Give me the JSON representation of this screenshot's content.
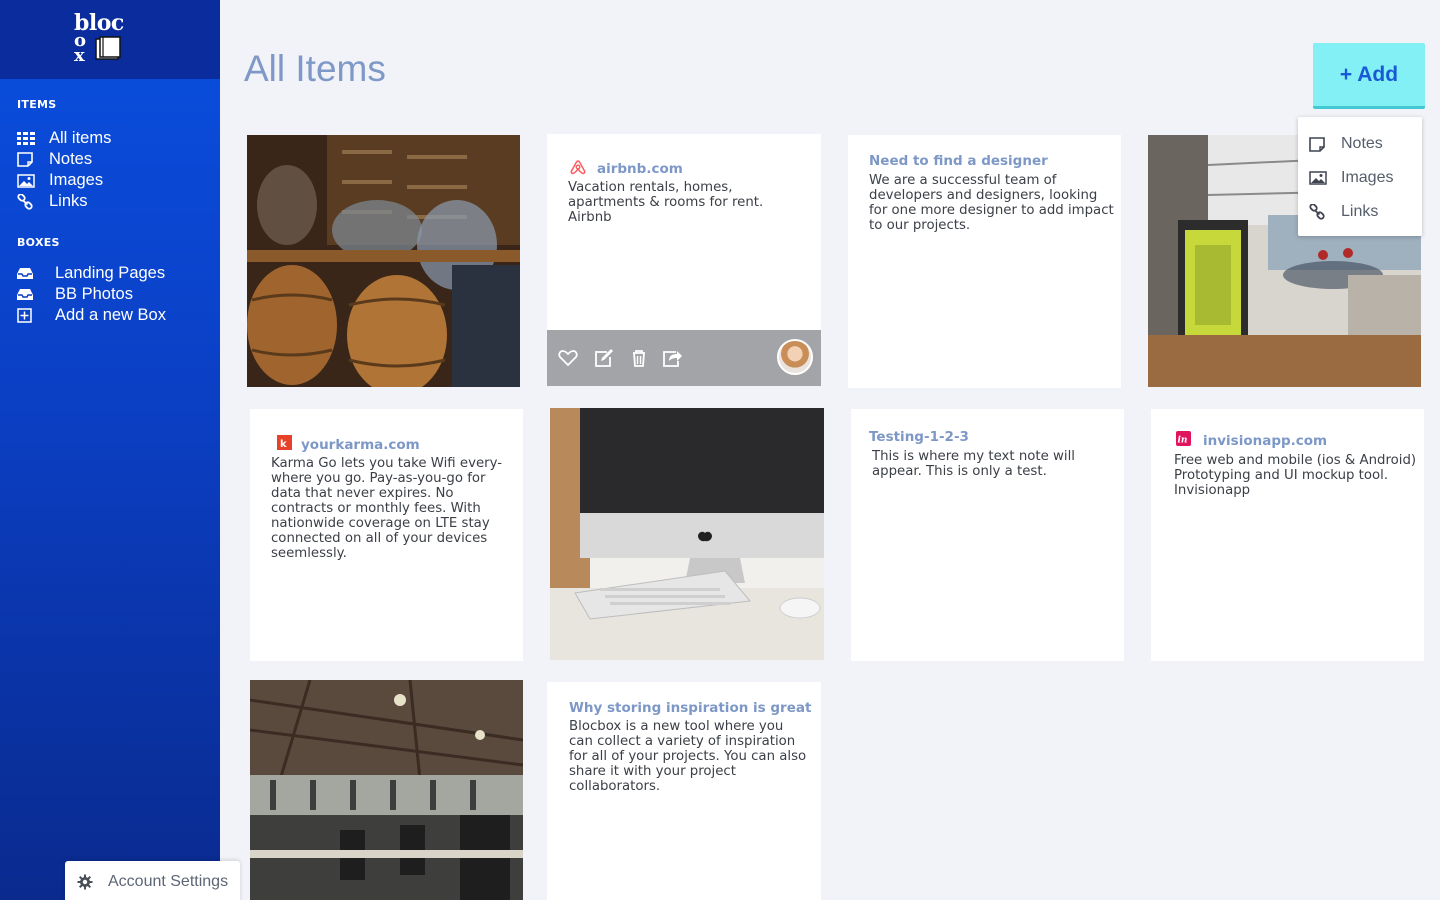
{
  "app": {
    "logo": {
      "line1": "bloc",
      "line2": "o",
      "line3": "x"
    },
    "page_title": "All Items",
    "add_button": "+ Add"
  },
  "sidebar": {
    "items_title": "ITEMS",
    "items": [
      {
        "label": "All items",
        "icon": "grid-icon"
      },
      {
        "label": "Notes",
        "icon": "note-icon"
      },
      {
        "label": "Images",
        "icon": "image-icon"
      },
      {
        "label": "Links",
        "icon": "link-icon"
      }
    ],
    "boxes_title": "BOXES",
    "boxes": [
      {
        "label": "Landing Pages",
        "icon": "inbox-icon"
      },
      {
        "label": "BB Photos",
        "icon": "inbox-icon"
      },
      {
        "label": "Add a new Box",
        "icon": "plus-box-icon"
      }
    ],
    "account": "Account Settings"
  },
  "add_menu": [
    {
      "label": "Notes",
      "icon": "note-icon"
    },
    {
      "label": "Images",
      "icon": "image-icon"
    },
    {
      "label": "Links",
      "icon": "link-icon"
    }
  ],
  "cards": {
    "airbnb": {
      "title": "airbnb.com",
      "text": "Vacation rentals, homes, apartments & rooms for rent. Airbnb"
    },
    "designer": {
      "title": "Need to find a designer",
      "text": "We are a successful team of developers and designers, looking for one more designer to add impact to our projects."
    },
    "karma": {
      "title": "yourkarma.com",
      "text": "Karma Go lets you take Wifi every-where you go. Pay-as-you-go for data that never expires. No contracts or monthly fees. With nationwide coverage on LTE stay connected on all of your devices seemlessly."
    },
    "testing": {
      "title": "Testing-1-2-3",
      "text": "This is where my text note will appear.  This is only a test."
    },
    "invision": {
      "title": "invisionapp.com",
      "text": "Free web and mobile (ios & Android) Prototyping and UI mockup tool. Invisionapp"
    },
    "inspiration": {
      "title": "Why storing inspiration is great",
      "text": "Blocbox is a new tool where you can collect a variety of inspiration for all of your projects.  You can also share it with your project collaborators."
    }
  },
  "colors": {
    "sidebar": "#0a4fe0",
    "accent": "#82f0f4",
    "title": "#7e99c7",
    "card_title": "#7d98c6"
  }
}
